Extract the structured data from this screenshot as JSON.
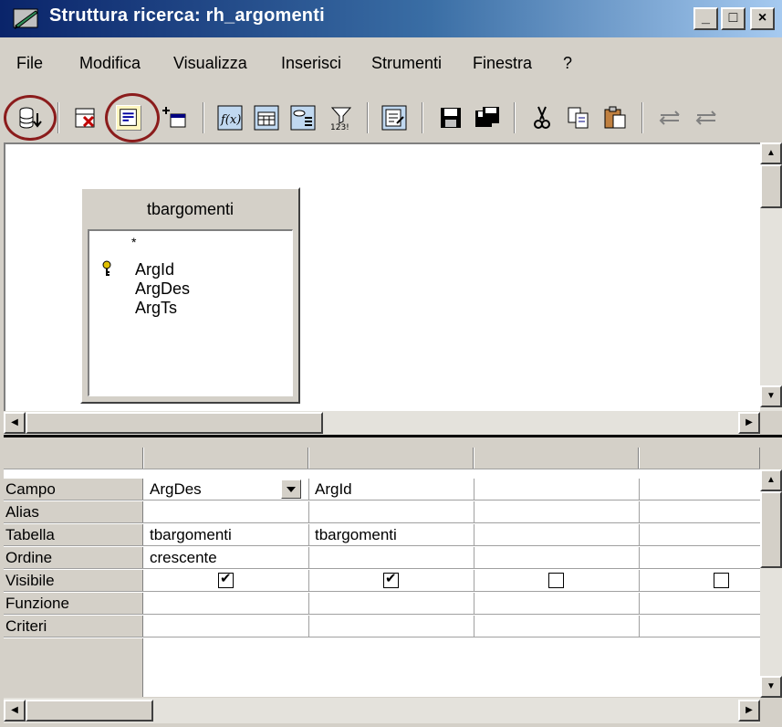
{
  "window": {
    "title": "Struttura ricerca: rh_argomenti",
    "minimize": "_",
    "maximize": "□",
    "close": "×"
  },
  "menu": [
    "File",
    "Modifica",
    "Visualizza",
    "Inserisci",
    "Strumenti",
    "Finestra",
    "?"
  ],
  "toolbar": {
    "icons": [
      "run-query-icon",
      "delete-table-icon",
      "design-view-icon",
      "add-table-icon",
      "functions-icon",
      "table-name-icon",
      "alias-icon",
      "distinct-values-icon",
      "sql-mode-icon",
      "save-icon",
      "save-as-icon",
      "cut-icon",
      "copy-icon",
      "paste-icon",
      "undo-icon",
      "redo-icon"
    ]
  },
  "table_window": {
    "name": "tbargomenti",
    "fields": [
      "*",
      "ArgId",
      "ArgDes",
      "ArgTs"
    ],
    "primary_key": "ArgId"
  },
  "grid": {
    "row_headers": [
      "Campo",
      "Alias",
      "Tabella",
      "Ordine",
      "Visibile",
      "Funzione",
      "Criteri"
    ],
    "columns": [
      {
        "campo": "ArgDes",
        "alias": "",
        "tabella": "tbargomenti",
        "ordine": "crescente",
        "visibile": true,
        "funzione": "",
        "criteri": ""
      },
      {
        "campo": "ArgId",
        "alias": "",
        "tabella": "tbargomenti",
        "ordine": "",
        "visibile": true,
        "funzione": "",
        "criteri": ""
      },
      {
        "campo": "",
        "alias": "",
        "tabella": "",
        "ordine": "",
        "visibile": false,
        "funzione": "",
        "criteri": ""
      },
      {
        "campo": "",
        "alias": "",
        "tabella": "",
        "ordine": "",
        "visibile": false,
        "funzione": "",
        "criteri": ""
      }
    ]
  }
}
